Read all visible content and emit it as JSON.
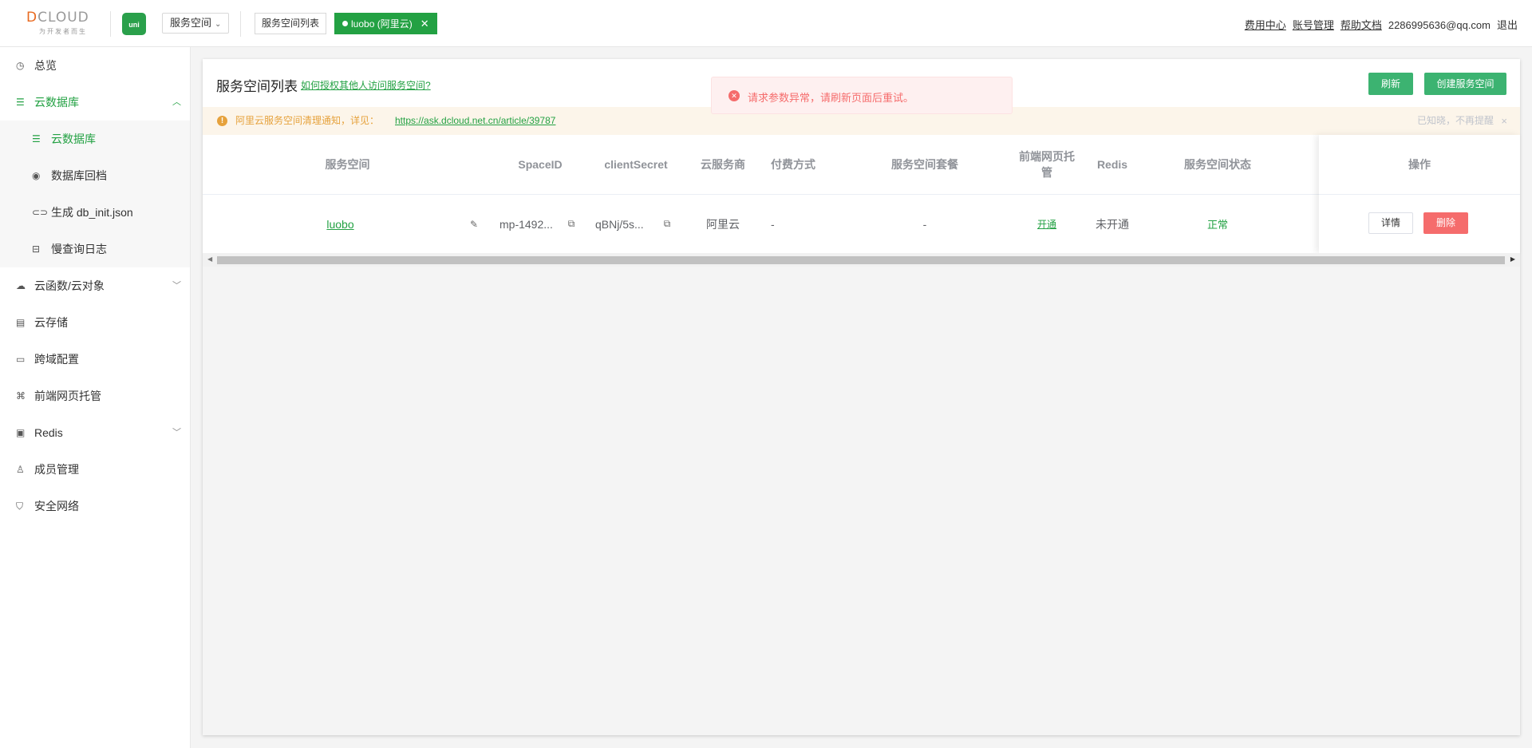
{
  "header": {
    "logo_text": "DCLOUD",
    "logo_sub": "为开发者而生",
    "uni_badge": "uni",
    "space_select": "服务空间",
    "tab_list": "服务空间列表",
    "tab_active": "luobo (阿里云)",
    "links": [
      "费用中心",
      "账号管理",
      "帮助文档"
    ],
    "email": "2286995636@qq.com",
    "logout": "退出"
  },
  "sidebar": {
    "items": [
      {
        "label": "总览",
        "icon": "clock-icon"
      },
      {
        "label": "云数据库",
        "icon": "database-icon",
        "expanded": true
      },
      {
        "label": "云函数/云对象",
        "icon": "cloud-icon"
      },
      {
        "label": "云存储",
        "icon": "storage-icon"
      },
      {
        "label": "跨域配置",
        "icon": "cors-icon"
      },
      {
        "label": "前端网页托管",
        "icon": "hosting-icon"
      },
      {
        "label": "Redis",
        "icon": "redis-icon"
      },
      {
        "label": "成员管理",
        "icon": "member-icon"
      },
      {
        "label": "安全网络",
        "icon": "shield-icon"
      }
    ],
    "subitems": [
      {
        "label": "云数据库",
        "icon": "database-icon"
      },
      {
        "label": "数据库回档",
        "icon": "restore-icon"
      },
      {
        "label": "生成 db_init.json",
        "icon": "link-icon"
      },
      {
        "label": "慢查询日志",
        "icon": "log-icon"
      }
    ]
  },
  "main": {
    "title": "服务空间列表",
    "help_link": "如何授权其他人访问服务空间?",
    "refresh": "刷新",
    "create": "创建服务空间",
    "notice": {
      "text": "阿里云服务空间清理通知，详见：",
      "link": "https://ask.dcloud.net.cn/article/39787",
      "dismiss": "已知晓，不再提醒",
      "close": "×"
    },
    "table": {
      "headers": {
        "space": "服务空间",
        "spaceid": "SpaceID",
        "secret": "clientSecret",
        "provider": "云服务商",
        "payment": "付费方式",
        "plan": "服务空间套餐",
        "hosting": "前端网页托管",
        "redis": "Redis",
        "status": "服务空间状态",
        "ops": "操作"
      },
      "row": {
        "space": "luobo",
        "spaceid": "mp-1492...",
        "secret": "qBNj/5s...",
        "provider": "阿里云",
        "payment": "-",
        "plan": "-",
        "hosting": "开通",
        "redis": "未开通",
        "status": "正常",
        "detail": "详情",
        "delete": "删除"
      }
    }
  },
  "toast": {
    "message": "请求参数异常，请刷新页面后重试。"
  },
  "colors": {
    "brand": "#23a143",
    "button": "#3cb371",
    "danger": "#f56c6c",
    "warning": "#e6a23c"
  }
}
